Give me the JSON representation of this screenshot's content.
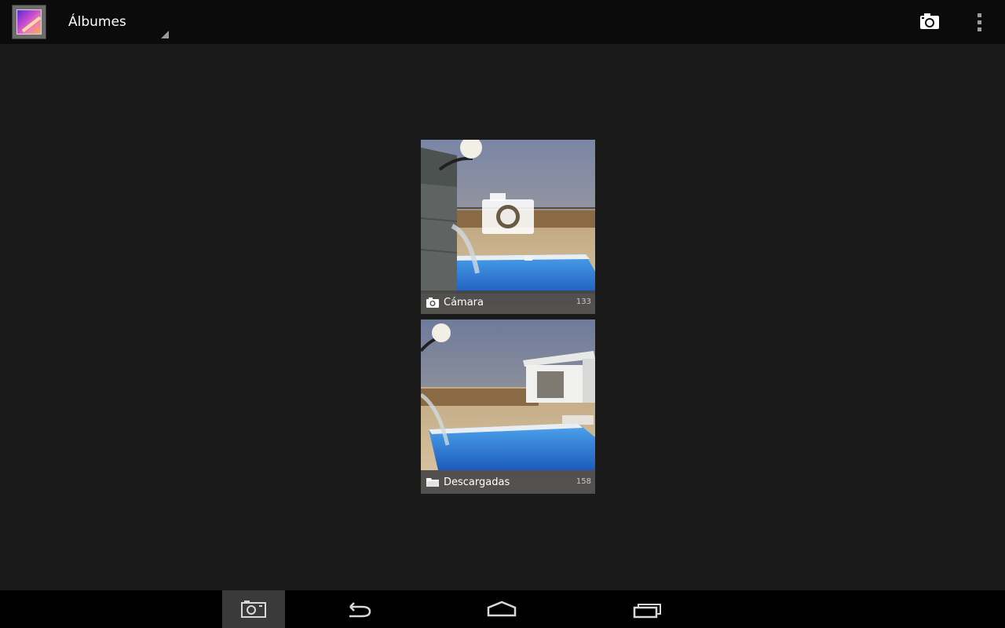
{
  "action_bar": {
    "title": "Álbumes",
    "app_icon": "gallery-app-icon",
    "actions": [
      {
        "name": "camera",
        "icon": "camera-icon"
      },
      {
        "name": "more-options",
        "icon": "overflow-menu-icon"
      }
    ]
  },
  "albums": [
    {
      "name": "Cámara",
      "count": "133",
      "icon": "camera-icon",
      "badge_icon": "camera-overlay-icon"
    },
    {
      "name": "Descargadas",
      "count": "158",
      "icon": "folder-icon"
    }
  ],
  "nav_bar": {
    "buttons": [
      {
        "name": "camera-shortcut",
        "icon": "camera-icon",
        "active": true
      },
      {
        "name": "back",
        "icon": "back-icon"
      },
      {
        "name": "home",
        "icon": "home-icon"
      },
      {
        "name": "recent-apps",
        "icon": "recents-icon"
      }
    ]
  },
  "colors": {
    "background": "#1a1a1a",
    "action_bar": "#0b0b0b",
    "nav_bar": "#000000",
    "label_bar": "#464646",
    "pool_water": "#2f7fd8"
  }
}
